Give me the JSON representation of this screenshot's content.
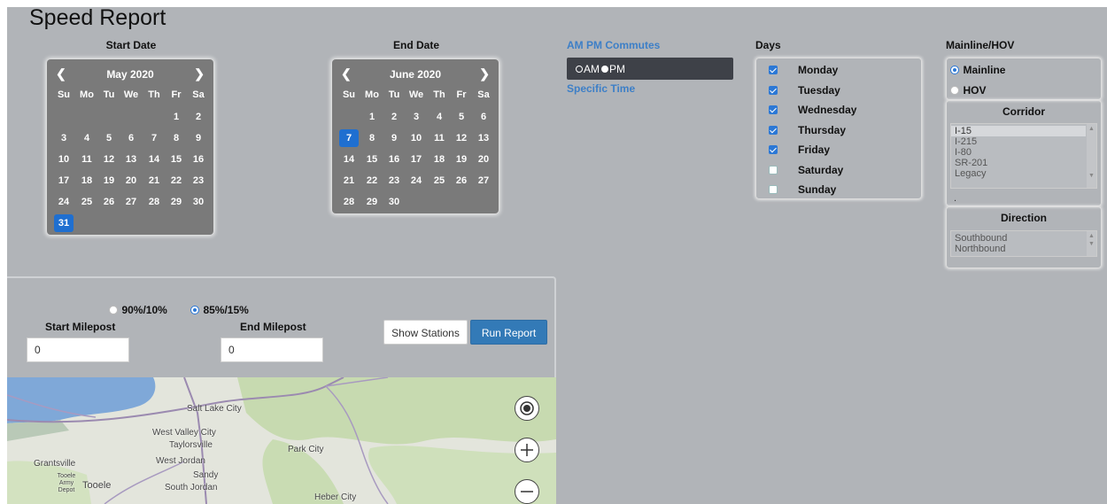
{
  "title": "Speed Report",
  "start_date": {
    "label": "Start Date",
    "month_label": "May 2020",
    "dow": [
      "Su",
      "Mo",
      "Tu",
      "We",
      "Th",
      "Fr",
      "Sa"
    ],
    "weeks": [
      [
        "",
        "",
        "",
        "",
        "",
        "1",
        "2"
      ],
      [
        "3",
        "4",
        "5",
        "6",
        "7",
        "8",
        "9"
      ],
      [
        "10",
        "11",
        "12",
        "13",
        "14",
        "15",
        "16"
      ],
      [
        "17",
        "18",
        "19",
        "20",
        "21",
        "22",
        "23"
      ],
      [
        "24",
        "25",
        "26",
        "27",
        "28",
        "29",
        "30"
      ],
      [
        "31",
        "",
        "",
        "",
        "",
        "",
        ""
      ]
    ],
    "selected": "31"
  },
  "end_date": {
    "label": "End Date",
    "month_label": "June 2020",
    "dow": [
      "Su",
      "Mo",
      "Tu",
      "We",
      "Th",
      "Fr",
      "Sa"
    ],
    "weeks": [
      [
        "",
        "1",
        "2",
        "3",
        "4",
        "5",
        "6"
      ],
      [
        "7",
        "8",
        "9",
        "10",
        "11",
        "12",
        "13"
      ],
      [
        "14",
        "15",
        "16",
        "17",
        "18",
        "19",
        "20"
      ],
      [
        "21",
        "22",
        "23",
        "24",
        "25",
        "26",
        "27"
      ],
      [
        "28",
        "29",
        "30",
        "",
        "",
        "",
        ""
      ]
    ],
    "selected": "7"
  },
  "commutes": {
    "label": "AM PM Commutes",
    "am_label": "AM",
    "pm_label": "PM",
    "specific_time_label": "Specific Time"
  },
  "days": {
    "label": "Days",
    "items": [
      {
        "label": "Monday",
        "checked": true
      },
      {
        "label": "Tuesday",
        "checked": true
      },
      {
        "label": "Wednesday",
        "checked": true
      },
      {
        "label": "Thursday",
        "checked": true
      },
      {
        "label": "Friday",
        "checked": true
      },
      {
        "label": "Saturday",
        "checked": false
      },
      {
        "label": "Sunday",
        "checked": false
      }
    ]
  },
  "mainline_hov": {
    "label": "Mainline/HOV",
    "mainline_label": "Mainline",
    "hov_label": "HOV",
    "selected": "Mainline"
  },
  "corridor": {
    "label": "Corridor",
    "options": [
      "I-15",
      "I-215",
      "I-80",
      "SR-201",
      "Legacy"
    ],
    "selected": "I-15",
    "extra": "."
  },
  "direction": {
    "label": "Direction",
    "options": [
      "Southbound",
      "Northbound"
    ]
  },
  "percentile": {
    "option1": "90%/10%",
    "option2": "85%/15%",
    "selected": "85%/15%"
  },
  "milepost": {
    "start_label": "Start Milepost",
    "start_value": "0",
    "end_label": "End Milepost",
    "end_value": "0"
  },
  "buttons": {
    "show_stations": "Show Stations",
    "run_report": "Run Report"
  },
  "map": {
    "cities": [
      "Salt Lake City",
      "West Valley City",
      "Taylorsville",
      "West Jordan",
      "Sandy",
      "South Jordan",
      "Grantsville",
      "Tooele",
      "Tooele Army Depot",
      "Park City",
      "Heber City"
    ]
  },
  "colors": {
    "background": "#b1b4b8",
    "accent": "#2b78d6",
    "run_button": "#337ab7",
    "calendar": "#7a7a7a"
  }
}
